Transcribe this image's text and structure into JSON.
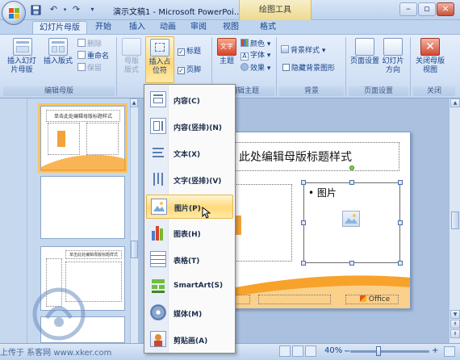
{
  "titlebar": {
    "window_title": "演示文稿1 - Microsoft PowerPoi...",
    "context_tool": "绘图工具",
    "undo_icon": "undo-icon",
    "redo_icon": "redo-icon"
  },
  "tabs": [
    "幻灯片母版",
    "开始",
    "插入",
    "动画",
    "审阅",
    "视图",
    "格式"
  ],
  "active_tab": "幻灯片母版",
  "ribbon": {
    "group_edit_master": {
      "label": "编辑母版",
      "insert_slide_master": "插入幻灯片母版",
      "insert_layout": "插入版式",
      "delete": "删除",
      "rename": "重命名",
      "preserve": "保留"
    },
    "group_master_layout": {
      "label": "母版版式",
      "master_layout": "母版版式",
      "insert_placeholder": "插入占位符",
      "title_checkbox": "标题",
      "footer_checkbox": "页脚",
      "title_checked": true,
      "footer_checked": true
    },
    "group_edit_theme": {
      "label": "编辑主题",
      "themes": "主题",
      "colors": "颜色",
      "fonts": "字体",
      "effects": "效果",
      "theme_icon_text": "文字"
    },
    "group_background": {
      "label": "背景",
      "background_styles": "背景样式",
      "hide_background": "隐藏背景图形"
    },
    "group_page_setup": {
      "label": "页面设置",
      "page_setup": "页面设置",
      "orientation": "幻灯片方向"
    },
    "group_close": {
      "label": "关闭",
      "close_master_view": "关闭母版视图"
    }
  },
  "thumbnails": [
    {
      "num": "",
      "title": "单击此处编辑母版标题样式",
      "selected": true
    },
    {
      "num": "",
      "title": "",
      "selected": false
    },
    {
      "num": "",
      "title": "单击此处编辑母版标题样式",
      "selected": false
    }
  ],
  "slide": {
    "title": "此处编辑母版标题样式",
    "picture_placeholder": "• 图片",
    "office_logo": "Office"
  },
  "dropdown": {
    "items": [
      {
        "label": "内容(C)",
        "icon": "content-icon"
      },
      {
        "label": "内容(竖排)(N)",
        "icon": "content-vertical-icon"
      },
      {
        "label": "文本(X)",
        "icon": "text-icon"
      },
      {
        "label": "文字(竖排)(V)",
        "icon": "text-vertical-icon"
      },
      {
        "label": "图片(P)",
        "icon": "picture-icon"
      },
      {
        "label": "图表(H)",
        "icon": "chart-icon"
      },
      {
        "label": "表格(T)",
        "icon": "table-icon"
      },
      {
        "label": "SmartArt(S)",
        "icon": "smartart-icon"
      },
      {
        "label": "媒体(M)",
        "icon": "media-icon"
      },
      {
        "label": "剪贴画(A)",
        "icon": "clipart-icon"
      }
    ],
    "hover_index": 4
  },
  "statusbar": {
    "watermark": "上传于 系客网 www.xker.com",
    "zoom": "40%"
  },
  "colors": {
    "ribbon_text": "#15428b",
    "hover_gold": "#ffd97a",
    "selected_thumb": "#f7c465",
    "close_red": "#c9503a"
  }
}
